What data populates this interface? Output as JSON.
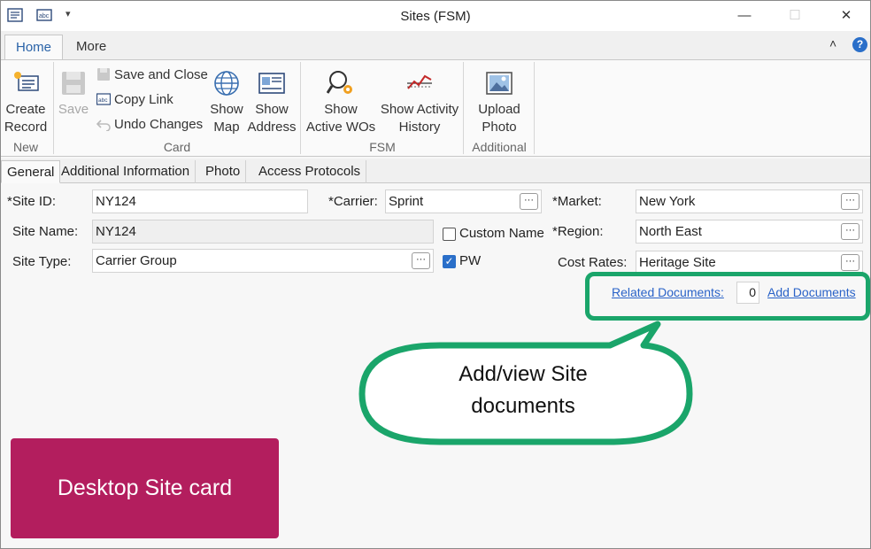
{
  "window": {
    "title": "Sites (FSM)",
    "minimize": "—",
    "maximize": "☐",
    "close": "✕"
  },
  "ribbon_tabs": [
    {
      "label": "Home",
      "active": true
    },
    {
      "label": "More",
      "active": false
    }
  ],
  "ribbon": {
    "collapse": "˄",
    "help": "?",
    "groups": {
      "new": "New",
      "card": "Card",
      "fsm": "FSM",
      "additional": "Additional"
    },
    "buttons": {
      "create_record_1": "Create",
      "create_record_2": "Record",
      "save": "Save",
      "save_and_close": "Save and Close",
      "copy_link": "Copy Link",
      "undo_changes": "Undo Changes",
      "show_map_1": "Show",
      "show_map_2": "Map",
      "show_address_1": "Show",
      "show_address_2": "Address",
      "show_active_wos_1": "Show",
      "show_active_wos_2": "Active WOs",
      "show_activity_history_1": "Show Activity",
      "show_activity_history_2": "History",
      "upload_photo_1": "Upload",
      "upload_photo_2": "Photo"
    }
  },
  "content_tabs": [
    {
      "label": "General",
      "active": true
    },
    {
      "label": "Additional Information",
      "active": false
    },
    {
      "label": "Photo",
      "active": false
    },
    {
      "label": "Access Protocols",
      "active": false
    }
  ],
  "form": {
    "site_id": {
      "label": "*Site ID:",
      "value": "NY124"
    },
    "site_name": {
      "label": "Site Name:",
      "value": "NY124"
    },
    "site_type": {
      "label": "Site Type:",
      "value": "Carrier Group"
    },
    "carrier": {
      "label": "*Carrier:",
      "value": "Sprint"
    },
    "custom_name": {
      "label": "Custom Name",
      "checked": false
    },
    "pw": {
      "label": "PW",
      "checked": true
    },
    "market": {
      "label": "*Market:",
      "value": "New York"
    },
    "region": {
      "label": "*Region:",
      "value": "North East"
    },
    "cost_rates": {
      "label": "Cost Rates:",
      "value": "Heritage Site"
    },
    "ellipsis": "···",
    "related_documents": {
      "label": "Related Documents:",
      "count": "0"
    },
    "add_documents": "Add Documents"
  },
  "annotations": {
    "callout_line1": "Add/view Site",
    "callout_line2": "documents",
    "badge": "Desktop Site card",
    "green": "#1aa56a",
    "magenta": "#b31e5e"
  }
}
